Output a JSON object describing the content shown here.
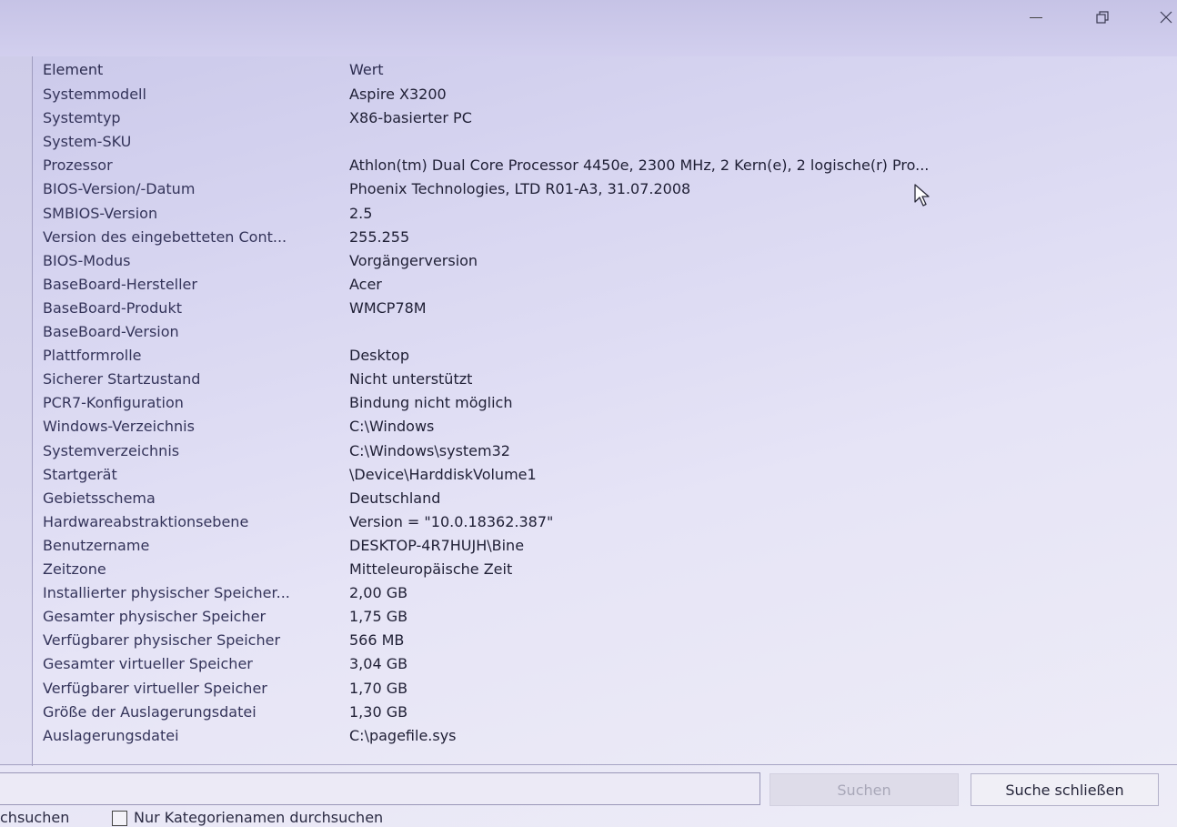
{
  "window": {
    "minimize_label": "—",
    "restore_label": "❐",
    "close_label": "✕"
  },
  "table": {
    "headers": [
      "Element",
      "Wert"
    ],
    "rows": [
      [
        "Systemmodell",
        "Aspire X3200"
      ],
      [
        "Systemtyp",
        "X86-basierter PC"
      ],
      [
        "System-SKU",
        ""
      ],
      [
        "Prozessor",
        "Athlon(tm) Dual Core Processor 4450e, 2300 MHz, 2 Kern(e), 2 logische(r) Pro..."
      ],
      [
        "BIOS-Version/-Datum",
        "Phoenix Technologies, LTD R01-A3, 31.07.2008"
      ],
      [
        "SMBIOS-Version",
        "2.5"
      ],
      [
        "Version des eingebetteten Cont...",
        "255.255"
      ],
      [
        "BIOS-Modus",
        "Vorgängerversion"
      ],
      [
        "BaseBoard-Hersteller",
        "Acer"
      ],
      [
        "BaseBoard-Produkt",
        "WMCP78M"
      ],
      [
        "BaseBoard-Version",
        ""
      ],
      [
        "Plattformrolle",
        "Desktop"
      ],
      [
        "Sicherer Startzustand",
        "Nicht unterstützt"
      ],
      [
        "PCR7-Konfiguration",
        "Bindung nicht möglich"
      ],
      [
        "Windows-Verzeichnis",
        "C:\\Windows"
      ],
      [
        "Systemverzeichnis",
        "C:\\Windows\\system32"
      ],
      [
        "Startgerät",
        "\\Device\\HarddiskVolume1"
      ],
      [
        "Gebietsschema",
        "Deutschland"
      ],
      [
        "Hardwareabstraktionsebene",
        "Version = \"10.0.18362.387\""
      ],
      [
        "Benutzername",
        "DESKTOP-4R7HUJH\\Bine"
      ],
      [
        "Zeitzone",
        "Mitteleuropäische Zeit"
      ],
      [
        "Installierter physischer Speicher...",
        "2,00 GB"
      ],
      [
        "Gesamter physischer Speicher",
        "1,75 GB"
      ],
      [
        "Verfügbarer physischer Speicher",
        "566 MB"
      ],
      [
        "Gesamter virtueller Speicher",
        "3,04 GB"
      ],
      [
        "Verfügbarer virtueller Speicher",
        "1,70 GB"
      ],
      [
        "Größe der Auslagerungsdatei",
        "1,30 GB"
      ],
      [
        "Auslagerungsdatei",
        "C:\\pagefile.sys"
      ]
    ]
  },
  "search": {
    "input_value": "",
    "search_button": "Suchen",
    "close_search_button": "Suche schließen",
    "search_selected_label": "chsuchen",
    "category_only_label": "Nur Kategorienamen durchsuchen",
    "category_only_checked": false
  }
}
